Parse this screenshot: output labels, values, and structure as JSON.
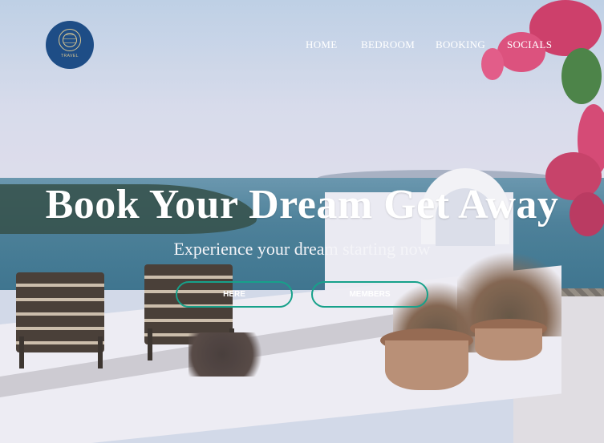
{
  "brand": {
    "logo_text": "TRAVEL"
  },
  "nav": {
    "items": [
      {
        "label": "HOME"
      },
      {
        "label": "BEDROOM"
      },
      {
        "label": "BOOKING"
      },
      {
        "label": "SOCIALS"
      }
    ]
  },
  "hero": {
    "title": "Book Your Dream Get Away",
    "subtitle": "Experience your dream starting now",
    "buttons": [
      {
        "label": "HERE"
      },
      {
        "label": "MEMBERS"
      }
    ]
  },
  "colors": {
    "button_border": "#17a18a",
    "logo_bg": "#1e4d86",
    "logo_accent": "#d9c690",
    "text": "#ffffff"
  }
}
